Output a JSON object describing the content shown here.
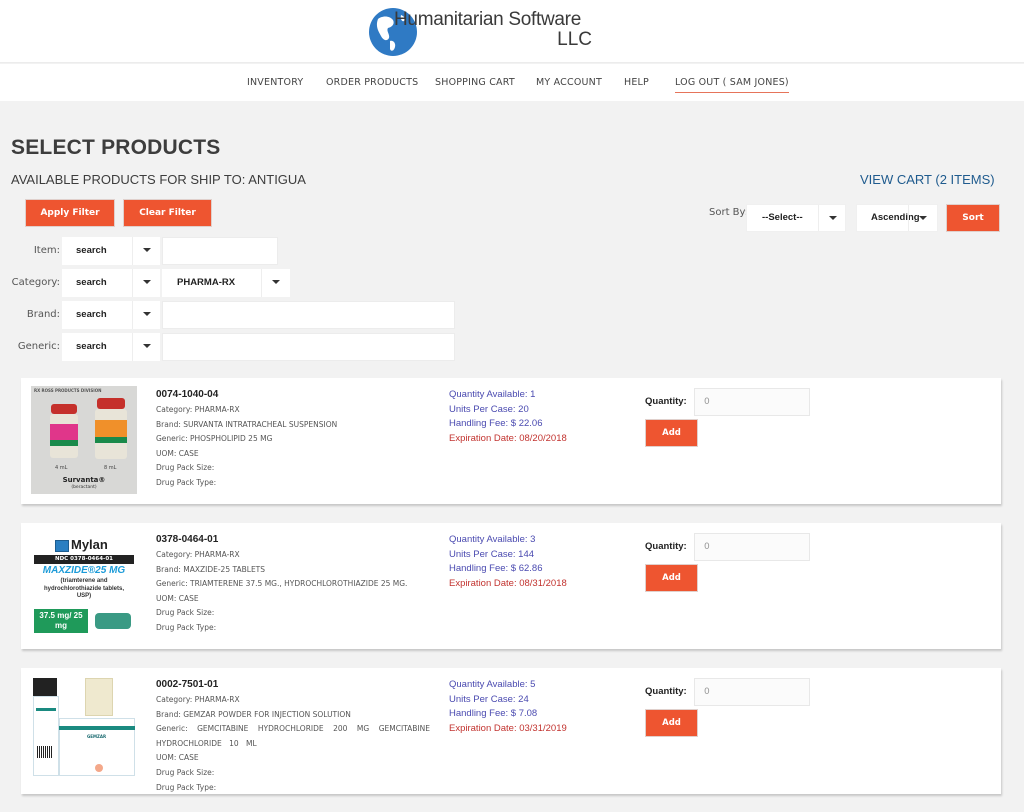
{
  "header": {
    "logo_line1": "Humanitarian Software",
    "logo_line2": "LLC"
  },
  "nav": {
    "items": [
      {
        "label": "INVENTORY"
      },
      {
        "label": "ORDER PRODUCTS"
      },
      {
        "label": "SHOPPING CART"
      },
      {
        "label": "MY ACCOUNT"
      },
      {
        "label": "HELP"
      },
      {
        "label": "LOG OUT ( SAM JONES)"
      }
    ]
  },
  "page": {
    "title": "SELECT PRODUCTS",
    "subtitle": "AVAILABLE PRODUCTS FOR SHIP TO: ANTIGUA",
    "view_cart": "VIEW CART (2 ITEMS)"
  },
  "filters": {
    "apply_label": "Apply Filter",
    "clear_label": "Clear Filter",
    "rows": [
      {
        "label": "Item:",
        "mode": "search",
        "value": ""
      },
      {
        "label": "Category:",
        "mode": "search",
        "value": "PHARMA-RX"
      },
      {
        "label": "Brand:",
        "mode": "search",
        "value": ""
      },
      {
        "label": "Generic:",
        "mode": "search",
        "value": ""
      }
    ]
  },
  "sort": {
    "label": "Sort By:",
    "field": "--Select--",
    "order": "Ascending",
    "button": "Sort"
  },
  "colors": {
    "accent": "#ee5530",
    "link": "#1f5b8e",
    "stat": "#4a4ab0",
    "expiry": "#c2332f"
  },
  "products": [
    {
      "code": "0074-1040-04",
      "category": "Category: PHARMA-RX",
      "brand": "Brand: SURVANTA INTRATRACHEAL SUSPENSION",
      "generic": "Generic: PHOSPHOLIPID 25 MG",
      "uom": "UOM: CASE",
      "pack_size": "Drug Pack Size:",
      "pack_type": "Drug Pack Type:",
      "qty_available": "Quantity Available: 1",
      "units_per_case": "Units Per Case: 20",
      "handling_fee": "Handling Fee: $ 22.06",
      "expiration": "Expiration Date: 08/20/2018",
      "quantity_label": "Quantity:",
      "quantity_value": "0",
      "add_label": "Add",
      "image": {
        "header": "RX      ROSS PRODUCTS DIVISION",
        "vial1": "4 mL",
        "vial2": "8 mL",
        "name": "Survanta®",
        "sub": "(beractant)"
      }
    },
    {
      "code": "0378-0464-01",
      "category": "Category: PHARMA-RX",
      "brand": "Brand: MAXZIDE-25 TABLETS",
      "generic": "Generic: TRIAMTERENE 37.5 MG., HYDROCHLOROTHIAZIDE 25 MG.",
      "uom": "UOM: CASE",
      "pack_size": "Drug Pack Size:",
      "pack_type": "Drug Pack Type:",
      "qty_available": "Quantity Available: 3",
      "units_per_case": "Units Per Case: 144",
      "handling_fee": "Handling Fee: $ 62.86",
      "expiration": "Expiration Date: 08/31/2018",
      "quantity_label": "Quantity:",
      "quantity_value": "0",
      "add_label": "Add",
      "image": {
        "brand": "Mylan",
        "ndc": "NDC 0378-0464-01",
        "name": "MAXZIDE®25 MG",
        "desc": "(triamterene and hydrochlorothiazide tablets, USP)",
        "dose": "37.5 mg/ 25 mg"
      }
    },
    {
      "code": "0002-7501-01",
      "category": "Category: PHARMA-RX",
      "brand": "Brand: GEMZAR POWDER FOR INJECTION SOLUTION",
      "generic": "Generic: GEMCITABINE HYDROCHLORIDE 200 MG GEMCITABINE HYDROCHLORIDE 10 ML",
      "uom": "UOM: CASE",
      "pack_size": "Drug Pack Size:",
      "pack_type": "Drug Pack Type:",
      "qty_available": "Quantity Available: 5",
      "units_per_case": "Units Per Case: 24",
      "handling_fee": "Handling Fee: $ 7.08",
      "expiration": "Expiration Date: 03/31/2019",
      "quantity_label": "Quantity:",
      "quantity_value": "0",
      "add_label": "Add",
      "image": {
        "name": "GEMZAR"
      }
    }
  ]
}
